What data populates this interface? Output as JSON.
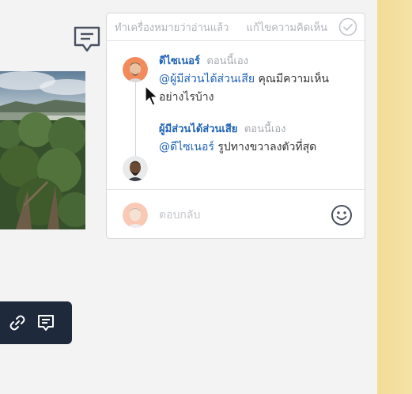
{
  "comment_panel": {
    "mark_read_label": "ทำเครื่องหมายว่าอ่านแล้ว",
    "edit_comment_label": "แก้ไขความคิดเห็น",
    "resolve_icon": "check-circle-icon",
    "comments": [
      {
        "author": "ดีไซเนอร์",
        "time": "ตอนนี้เอง",
        "mention": "@ผู้มีส่วนได้ส่วนเสีย",
        "text": "คุณมีความเห็นอย่างไรบ้าง"
      },
      {
        "author": "ผู้มีส่วนได้ส่วนเสีย",
        "time": "ตอนนี้เอง",
        "mention": "@ดีไซเนอร์",
        "text": "รูปทางขวาลงตัวที่สุด"
      }
    ],
    "reply": {
      "placeholder": "ตอบกลับ",
      "emoji_icon": "smiley-icon"
    }
  },
  "toolbar": {
    "icons": [
      "link-icon",
      "comment-icon"
    ]
  },
  "colors": {
    "accent": "#1f63b6",
    "toolbar_bg": "#1e2a3c",
    "right_strip": "#f2dc96"
  }
}
